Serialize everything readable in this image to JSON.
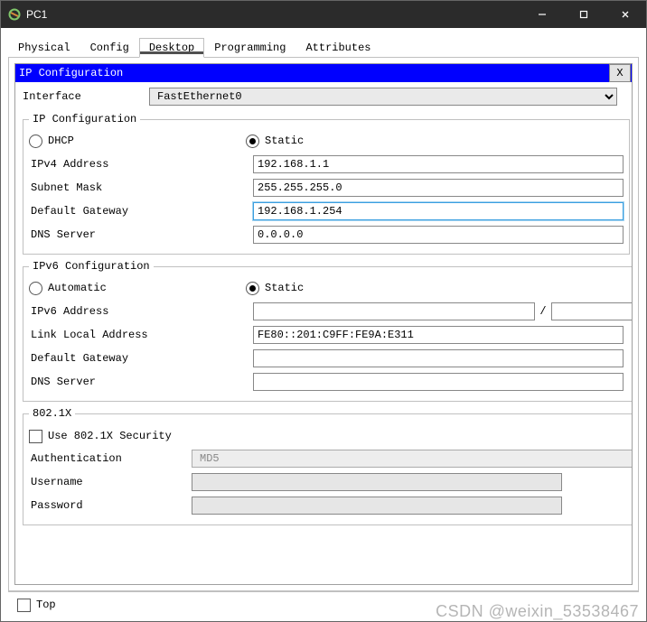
{
  "window": {
    "title": "PC1"
  },
  "tabs": {
    "physical": "Physical",
    "config": "Config",
    "desktop": "Desktop",
    "programming": "Programming",
    "attributes": "Attributes"
  },
  "panel": {
    "title": "IP Configuration",
    "close": "X"
  },
  "interface": {
    "label": "Interface",
    "value": "FastEthernet0"
  },
  "ip": {
    "legend": "IP Configuration",
    "dhcp": "DHCP",
    "static": "Static",
    "ipv4_label": "IPv4 Address",
    "ipv4_value": "192.168.1.1",
    "mask_label": "Subnet Mask",
    "mask_value": "255.255.255.0",
    "gw_label": "Default Gateway",
    "gw_value": "192.168.1.254",
    "dns_label": "DNS Server",
    "dns_value": "0.0.0.0"
  },
  "ipv6": {
    "legend": "IPv6 Configuration",
    "auto": "Automatic",
    "static": "Static",
    "addr_label": "IPv6 Address",
    "addr_value": "",
    "slash": "/",
    "prefix_value": "",
    "ll_label": "Link Local Address",
    "ll_value": "FE80::201:C9FF:FE9A:E311",
    "gw_label": "Default Gateway",
    "gw_value": "",
    "dns_label": "DNS Server",
    "dns_value": ""
  },
  "dot1x": {
    "legend": "802.1X",
    "use_label": "Use 802.1X Security",
    "auth_label": "Authentication",
    "auth_value": "MD5",
    "user_label": "Username",
    "user_value": "",
    "pass_label": "Password",
    "pass_value": ""
  },
  "footer": {
    "top": "Top"
  },
  "watermark": "CSDN @weixin_53538467"
}
